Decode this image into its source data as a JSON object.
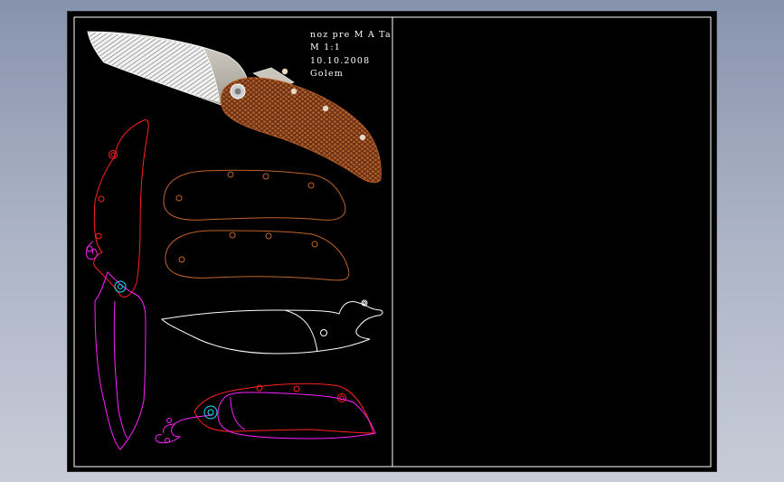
{
  "title_block": {
    "line1": "noz pre M A Ta",
    "line2": "M  1:1",
    "line3": "10.10.2008",
    "line4": "Golem"
  },
  "colors": {
    "background": "#000000",
    "frame": "#ffffff",
    "handle_outline": "#c0622a",
    "handle_fill": "#7a3a18",
    "red_parts": "#ff2020",
    "magenta_parts": "#ff20ff",
    "cyan_pivot": "#20e0ff",
    "blade_outline": "#ffffff"
  },
  "icons": {
    "knife_render": "folding-knife-icon"
  }
}
